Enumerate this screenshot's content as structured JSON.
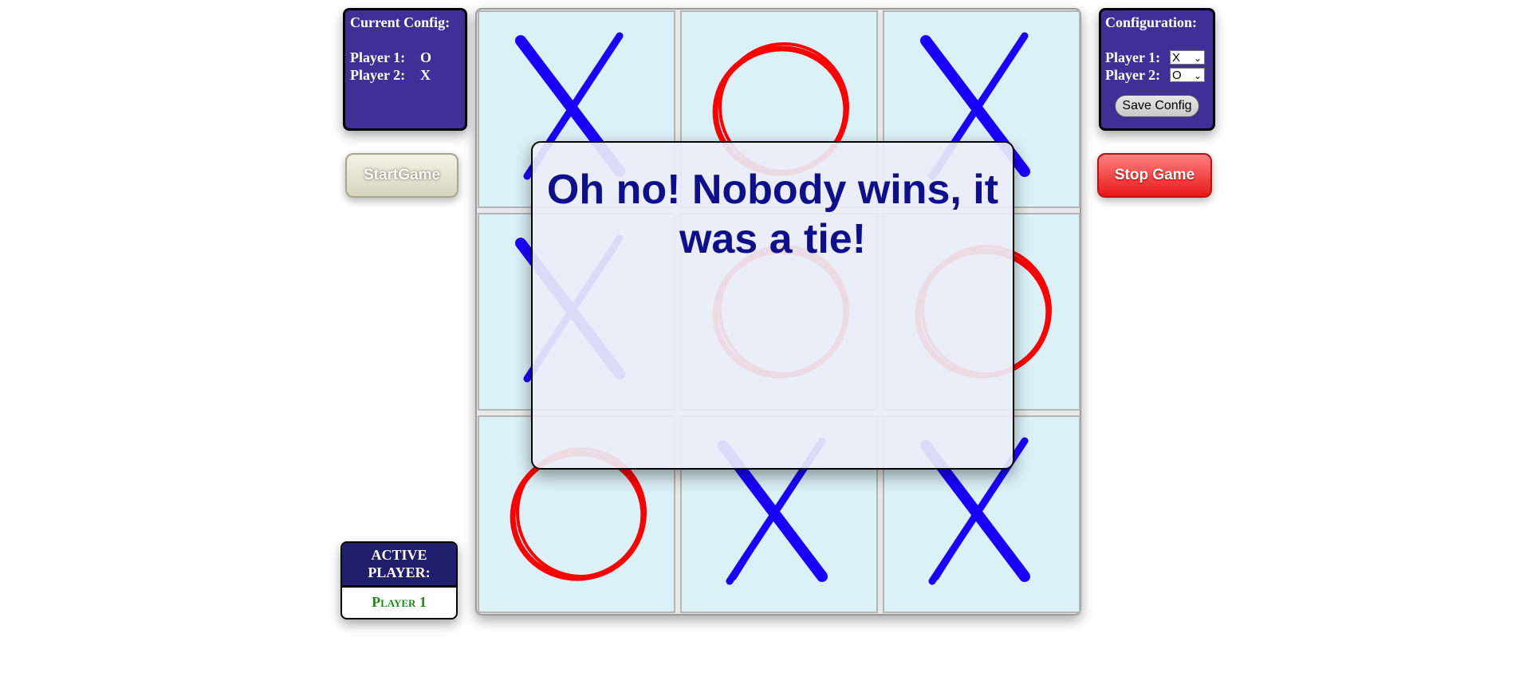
{
  "current_config": {
    "title": "Current Config:",
    "player1_label": "Player 1:",
    "player1_value": "O",
    "player2_label": "Player 2:",
    "player2_value": "X"
  },
  "configuration": {
    "title": "Configuration:",
    "player1_label": "Player 1:",
    "player1_selected": "X",
    "player2_label": "Player 2:",
    "player2_selected": "O",
    "save_label": "Save Config"
  },
  "buttons": {
    "start_label": "StartGame",
    "stop_label": "Stop Game"
  },
  "board": {
    "cells": [
      "X",
      "O",
      "X",
      "X",
      "O",
      "O",
      "O",
      "X",
      "X"
    ]
  },
  "active_player": {
    "title": "ACTIVE PLAYER:",
    "value": "Player 1"
  },
  "modal": {
    "message": "Oh no! Nobody wins, it was a tie!"
  },
  "colors": {
    "x": "#1a00ff",
    "o": "#ff0000",
    "panel": "#3f2f97",
    "cell": "#d9f1f7"
  }
}
